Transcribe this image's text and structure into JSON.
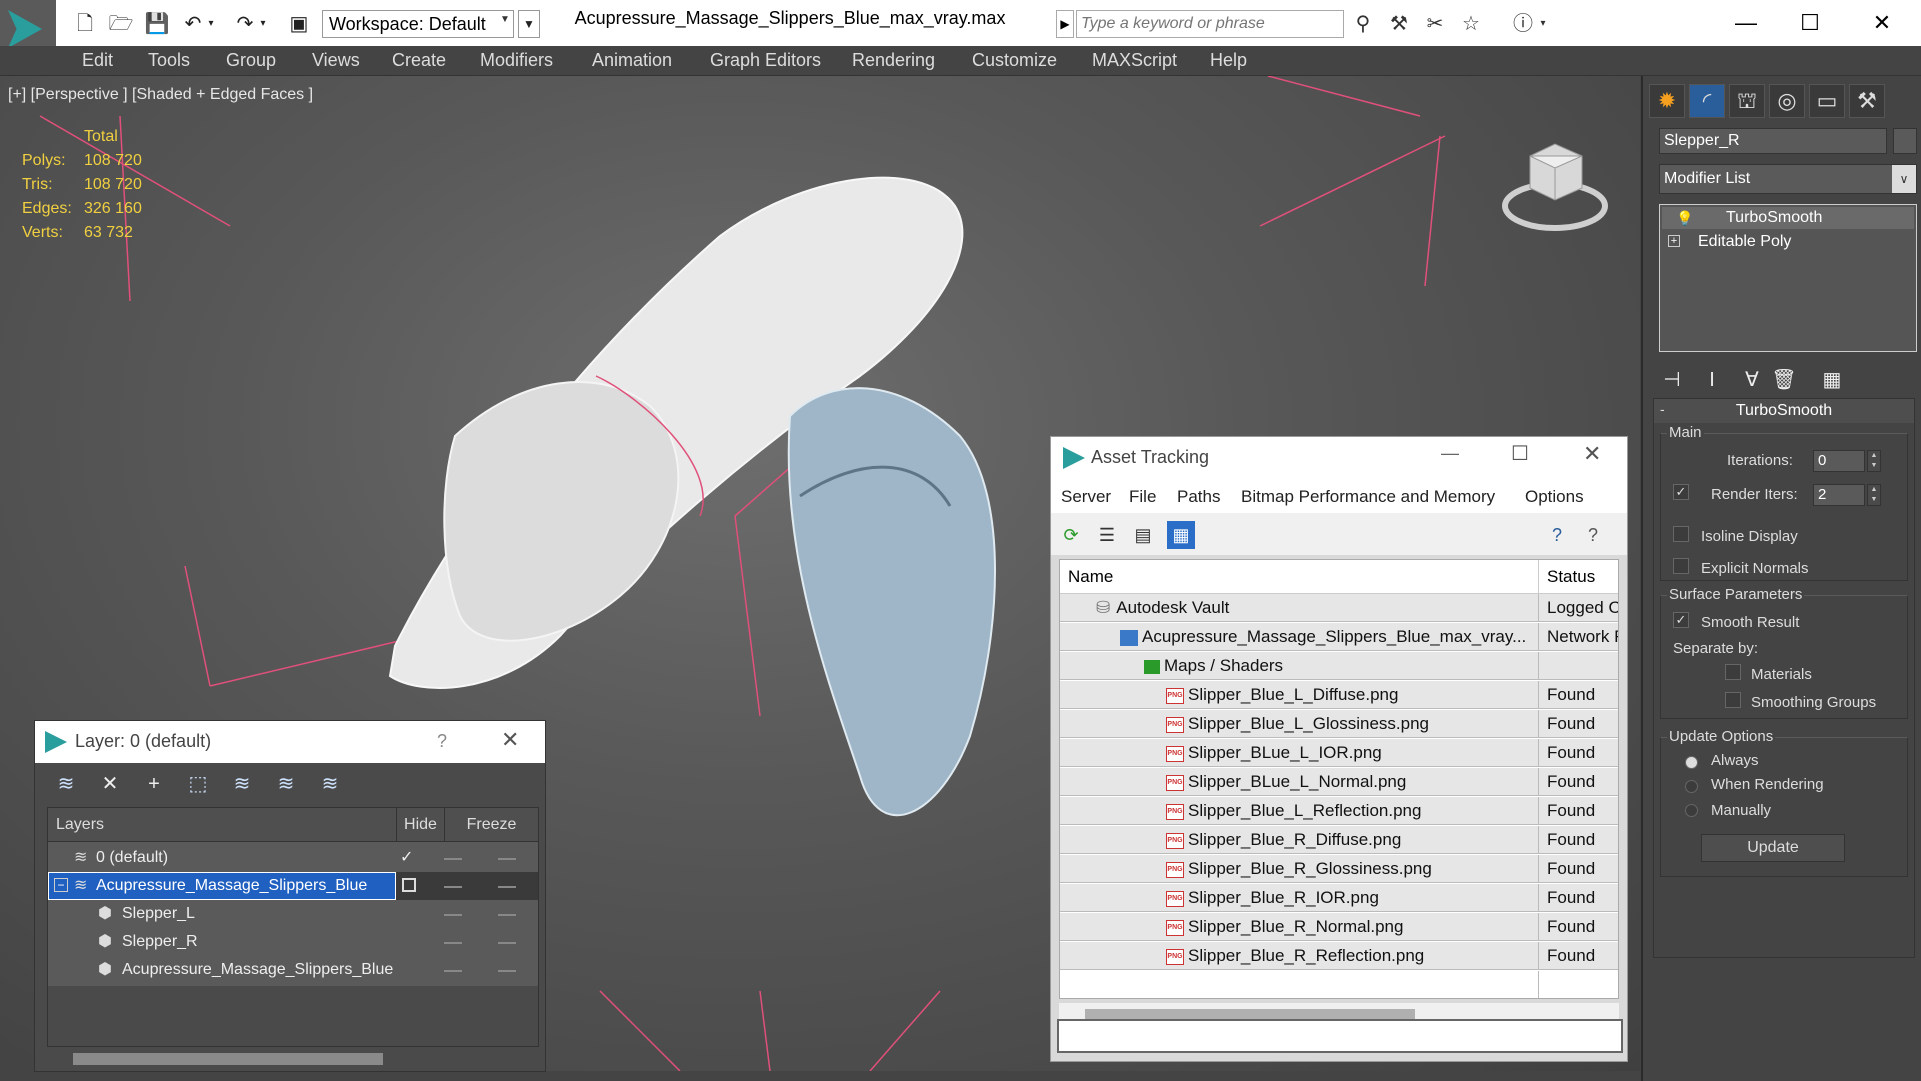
{
  "titlebar": {
    "workspace_label": "Workspace: Default",
    "document_title": "Acupressure_Massage_Slippers_Blue_max_vray.max",
    "search_placeholder": "Type a keyword or phrase"
  },
  "menubar": [
    "Edit",
    "Tools",
    "Group",
    "Views",
    "Create",
    "Modifiers",
    "Animation",
    "Graph Editors",
    "Rendering",
    "Customize",
    "MAXScript",
    "Help"
  ],
  "viewport": {
    "label": "[+] [Perspective ] [Shaded + Edged Faces ]",
    "stats_header": "Total",
    "stats": [
      {
        "label": "Polys:",
        "value": "108 720"
      },
      {
        "label": "Tris:",
        "value": "108 720"
      },
      {
        "label": "Edges:",
        "value": "326 160"
      },
      {
        "label": "Verts:",
        "value": "63 732"
      }
    ]
  },
  "command_panel": {
    "object_name": "Slepper_R",
    "modifier_list": "Modifier List",
    "stack": [
      "TurboSmooth",
      "Editable Poly"
    ],
    "rollout_title": "TurboSmooth",
    "main_group": "Main",
    "iterations_label": "Iterations:",
    "iterations_value": "0",
    "render_iters_label": "Render Iters:",
    "render_iters_value": "2",
    "isoline_label": "Isoline Display",
    "explicit_normals_label": "Explicit Normals",
    "surface_group": "Surface Parameters",
    "smooth_result_label": "Smooth Result",
    "separate_by_label": "Separate by:",
    "materials_label": "Materials",
    "smoothing_groups_label": "Smoothing Groups",
    "update_group": "Update Options",
    "update_options": [
      "Always",
      "When Rendering",
      "Manually"
    ],
    "update_button": "Update"
  },
  "asset_tracking": {
    "title": "Asset Tracking",
    "menu": [
      "Server",
      "File",
      "Paths",
      "Bitmap Performance and Memory",
      "Options"
    ],
    "col_name": "Name",
    "col_status": "Status",
    "rows": [
      {
        "name": "Autodesk Vault",
        "status": "Logged O"
      },
      {
        "name": "Acupressure_Massage_Slippers_Blue_max_vray...",
        "status": "Network F"
      },
      {
        "name": "Maps / Shaders",
        "status": ""
      },
      {
        "name": "Slipper_Blue_L_Diffuse.png",
        "status": "Found"
      },
      {
        "name": "Slipper_Blue_L_Glossiness.png",
        "status": "Found"
      },
      {
        "name": "Slipper_BLue_L_IOR.png",
        "status": "Found"
      },
      {
        "name": "Slipper_BLue_L_Normal.png",
        "status": "Found"
      },
      {
        "name": "Slipper_Blue_L_Reflection.png",
        "status": "Found"
      },
      {
        "name": "Slipper_Blue_R_Diffuse.png",
        "status": "Found"
      },
      {
        "name": "Slipper_Blue_R_Glossiness.png",
        "status": "Found"
      },
      {
        "name": "Slipper_Blue_R_IOR.png",
        "status": "Found"
      },
      {
        "name": "Slipper_Blue_R_Normal.png",
        "status": "Found"
      },
      {
        "name": "Slipper_Blue_R_Reflection.png",
        "status": "Found"
      }
    ]
  },
  "layer_dialog": {
    "title": "Layer: 0 (default)",
    "help": "?",
    "col_layers": "Layers",
    "col_hide": "Hide",
    "col_freeze": "Freeze",
    "rows": [
      "0 (default)",
      "Acupressure_Massage_Slippers_Blue",
      "Slepper_L",
      "Slepper_R",
      "Acupressure_Massage_Slippers_Blue"
    ]
  },
  "colors": {
    "accent": "#2a9d9d",
    "stats_yellow": "#f0d040",
    "selection_blue": "#2060c0"
  }
}
